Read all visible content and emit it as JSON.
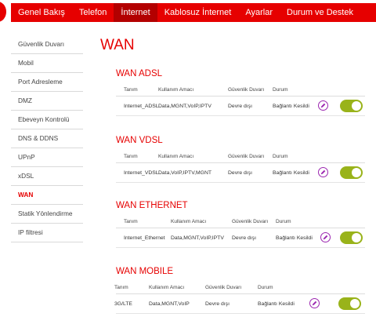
{
  "nav": {
    "items": [
      {
        "label": "Genel Bakış"
      },
      {
        "label": "Telefon"
      },
      {
        "label": "İnternet"
      },
      {
        "label": "Kablosuz İnternet"
      },
      {
        "label": "Ayarlar"
      },
      {
        "label": "Durum ve Destek"
      }
    ],
    "active_index": 2
  },
  "sidebar": {
    "items": [
      {
        "label": "Güvenlik Duvarı"
      },
      {
        "label": "Mobil"
      },
      {
        "label": "Port Adresleme"
      },
      {
        "label": "DMZ"
      },
      {
        "label": "Ebeveyn Kontrolü"
      },
      {
        "label": "DNS & DDNS"
      },
      {
        "label": "UPnP"
      },
      {
        "label": "xDSL"
      },
      {
        "label": "WAN"
      },
      {
        "label": "Statik Yönlendirme"
      },
      {
        "label": "IP filtresi"
      }
    ],
    "active_index": 8
  },
  "page": {
    "title": "WAN"
  },
  "sections": [
    {
      "title": "WAN ADSL",
      "headers": [
        "Tanım",
        "Kullanım Amacı",
        "Güvenlik Duvarı",
        "Durum"
      ],
      "row": {
        "name": "Internet_ADSL",
        "purpose": "Data,MGNT,VoIP,IPTV",
        "firewall": "Devre dışı",
        "status": "Bağlantı Kesildi",
        "enabled": true
      }
    },
    {
      "title": "WAN VDSL",
      "headers": [
        "Tanım",
        "Kullanım Amacı",
        "Güvenlik Duvarı",
        "Durum"
      ],
      "row": {
        "name": "Internet_VDSL",
        "purpose": "Data,VoIP,IPTV,MGNT",
        "firewall": "Devre dışı",
        "status": "Bağlantı Kesildi",
        "enabled": true
      }
    },
    {
      "title": "WAN ETHERNET",
      "headers": [
        "Tanım",
        "Kullanım Amacı",
        "Güvenlik Duvarı",
        "Durum"
      ],
      "row": {
        "name": "Internet_Ethernet",
        "purpose": "Data,MGNT,VoIP,IPTV",
        "firewall": "Devre dışı",
        "status": "Bağlantı Kesildi",
        "enabled": true
      }
    },
    {
      "title": "WAN MOBILE",
      "headers": [
        "Tanım",
        "Kullanım Amacı",
        "Güvenlik Duvarı",
        "Durum"
      ],
      "row": {
        "name": "3G/LTE",
        "purpose": "Data,MGNT,VoIP",
        "firewall": "Devre dışı",
        "status": "Bağlantı Kesildi",
        "enabled": true
      }
    }
  ],
  "icons": {
    "edit": "pencil-icon"
  },
  "colors": {
    "brand": "#e60000",
    "active_nav": "#b30000",
    "toggle_on": "#99b31a",
    "edit_icon": "#9c27b0"
  }
}
